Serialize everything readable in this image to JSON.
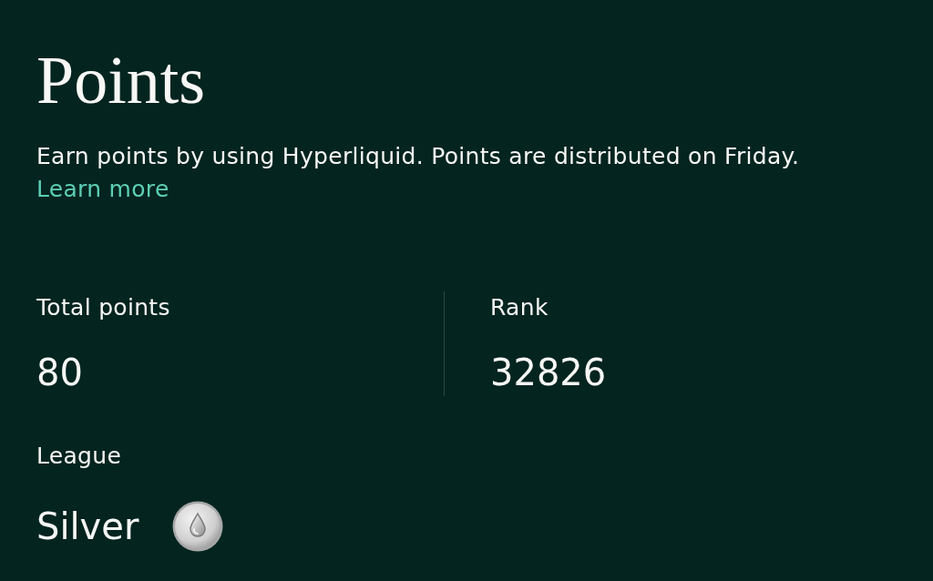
{
  "title": "Points",
  "description": "Earn points by using Hyperliquid. Points are distributed on Friday.",
  "learn_more": "Learn more",
  "stats": [
    {
      "label": "Total points",
      "value": "80"
    },
    {
      "label": "Rank",
      "value": "32826"
    }
  ],
  "league": {
    "label": "League",
    "value": "Silver"
  }
}
